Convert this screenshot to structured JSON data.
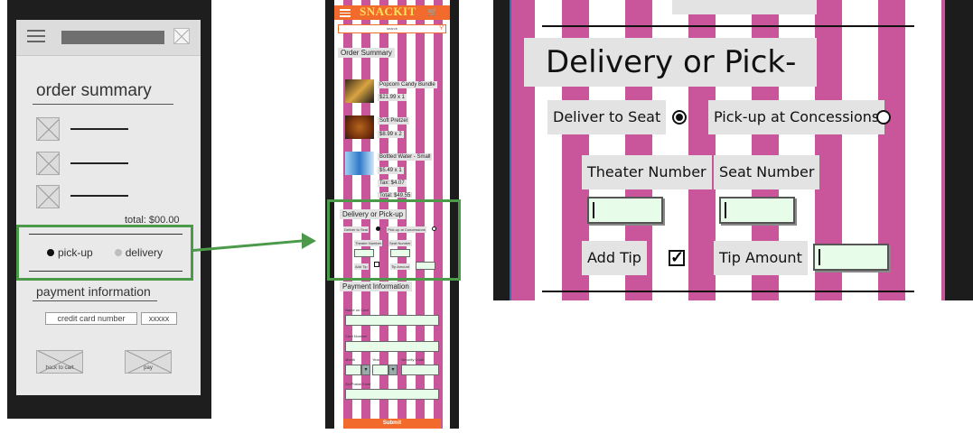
{
  "wireframe": {
    "clip_title": "...",
    "order_summary_title": "order summary",
    "total": "total: $00.00",
    "pickup_label": "pick-up",
    "delivery_label": "delivery",
    "payment_title": "payment information",
    "credit_card_placeholder": "credit card number",
    "cvv_placeholder": "xxxxx",
    "back_button": "back to cart",
    "pay_button": "pay"
  },
  "mockup": {
    "logo": "SNACKIT",
    "search_placeholder": "search",
    "order_summary_title": "Order Summary",
    "items": [
      {
        "name": "Popcorn Candy Bundle",
        "price": "$21.99 x 1"
      },
      {
        "name": "Soft Pretzel",
        "price": "$8.99 x 2"
      },
      {
        "name": "Bottled Water - Small",
        "price": "$5.49 x 1"
      }
    ],
    "tax": "Tax: $4.07",
    "total": "Total: $49.55",
    "delivery_title": "Delivery or Pick-up",
    "deliver_to_seat": "Deliver to Seat",
    "pickup_concessions": "Pick-up at Concessions",
    "theater_number": "Theater Number",
    "seat_number": "Seat Number",
    "add_tip": "Add Tip",
    "tip_amount": "Tip Amount",
    "payment_title": "Payment Information",
    "name_on_card": "Name on Card",
    "card_number": "Card Number",
    "month": "Month",
    "year": "Year",
    "security_code": "Security Code",
    "zip_code": "Zip/Postal Code",
    "submit": "Submit"
  },
  "detail": {
    "title": "Delivery or Pick-up",
    "deliver_to_seat": "Deliver to Seat",
    "deliver_selected": true,
    "pickup_concessions": "Pick-up at Concessions",
    "theater_number": "Theater Number",
    "seat_number": "Seat Number",
    "add_tip": "Add Tip",
    "add_tip_checked": true,
    "tip_amount": "Tip Amount"
  },
  "colors": {
    "accent_green": "#4a9a4a",
    "brand_orange": "#f26b2c",
    "stripe_pink": "#c9569a",
    "input_green": "#e7fde9"
  }
}
